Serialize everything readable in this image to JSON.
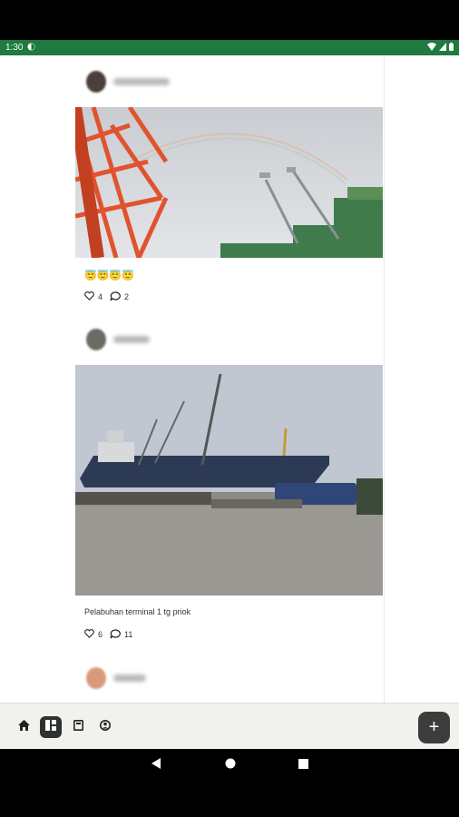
{
  "status_bar": {
    "time": "1:30"
  },
  "posts": [
    {
      "username": "",
      "emoji": "😇😇😇😇",
      "likes": "4",
      "comments": "2",
      "image_alt": "Red port crane with rainbow over container terminal"
    },
    {
      "username": "",
      "caption": "Pelabuhan terminal 1 tg priok",
      "likes": "6",
      "comments": "11",
      "image_alt": "Cargo ship docked with cranes at terminal"
    },
    {
      "username": ""
    }
  ],
  "bottom_nav": {
    "items": [
      {
        "icon": "home-icon"
      },
      {
        "icon": "feed-icon",
        "active": true
      },
      {
        "icon": "bookmark-icon"
      },
      {
        "icon": "account-icon"
      }
    ],
    "fab_label": "+"
  },
  "colors": {
    "status_bar": "#1e7a3e",
    "nav_bg": "#f1f1ed",
    "fab": "#3a3d3b"
  }
}
